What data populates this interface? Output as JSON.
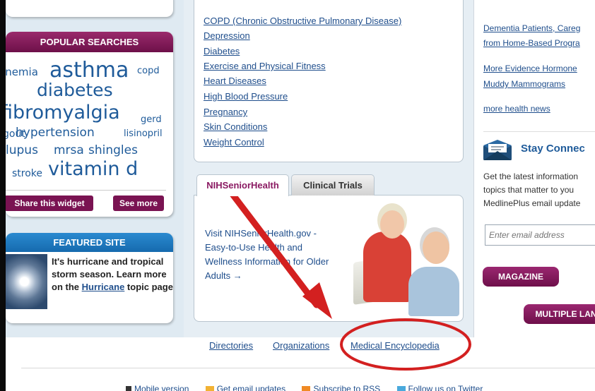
{
  "left": {
    "popular_searches": {
      "title": "POPULAR SEARCHES",
      "words": {
        "anemia": "anemia",
        "asthma": "asthma",
        "copd": "copd",
        "diabetes": "diabetes",
        "fibromyalgia": "fibromyalgia",
        "gerd": "gerd",
        "gout": "gout",
        "hypertension": "hypertension",
        "lisinopril": "lisinopril",
        "lupus": "lupus",
        "mrsa": "mrsa",
        "shingles": "shingles",
        "stroke": "stroke",
        "vitamin_d": "vitamin d"
      },
      "share_label": "Share this widget",
      "see_more_label": "See more"
    },
    "featured_site": {
      "title": "FEATURED SITE",
      "text_before": "It's hurricane and tropical storm season. Learn more on the ",
      "link": "Hurricane",
      "text_after": " topic page"
    }
  },
  "topics": [
    "COPD (Chronic Obstructive Pulmonary Disease)",
    "Depression",
    "Diabetes",
    "Exercise and Physical Fitness",
    "Heart Diseases",
    "High Blood Pressure",
    "Pregnancy",
    "Skin Conditions",
    "Weight Control"
  ],
  "tabs": {
    "nih": "NIHSeniorHealth",
    "clinical": "Clinical Trials",
    "nih_text": "Visit NIHSeniorHealth.gov - Easy-to-Use Health and Wellness Information for Older Adults →"
  },
  "footer_links": {
    "directories": "Directories",
    "organizations": "Organizations",
    "medical_encyclopedia": "Medical Encyclopedia"
  },
  "bottom_bar": {
    "mobile": "Mobile version",
    "email": "Get email updates",
    "rss": "Subscribe to RSS",
    "twitter": "Follow us on Twitter"
  },
  "right": {
    "news": [
      "Dementia Patients, Careg",
      "from Home-Based Progra",
      "More Evidence Hormone",
      "Muddy Mammograms"
    ],
    "more_news": "more health news",
    "stay_connected": "Stay Connec",
    "stay_desc_1": "Get the latest information",
    "stay_desc_2": "topics that matter to you",
    "stay_desc_3": "MedlinePlus email update",
    "email_placeholder": "Enter email address",
    "magazine": "MAGAZINE",
    "multiple_languages": "MULTIPLE LAN"
  },
  "colors": {
    "accent_purple": "#7a1352",
    "accent_blue": "#166aae",
    "link_blue": "#1f4e8c",
    "annotation_red": "#d32020"
  }
}
